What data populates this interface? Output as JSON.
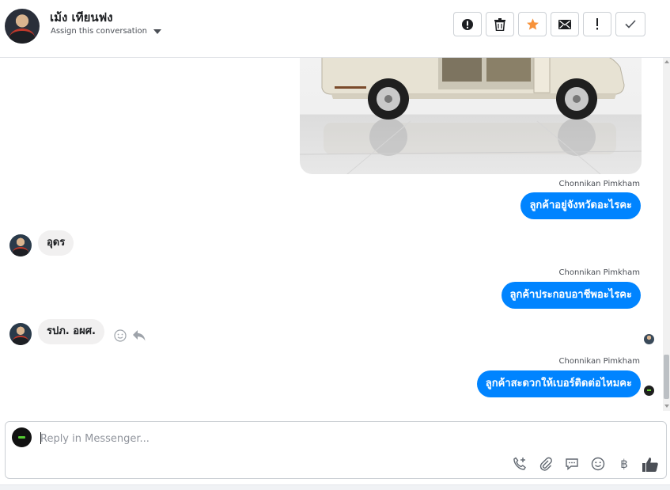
{
  "header": {
    "contact_name": "เม้ง เทียนฟง",
    "assign_label": "Assign this conversation",
    "actions": [
      {
        "name": "mark-spam-button",
        "icon": "alert-circle-icon"
      },
      {
        "name": "delete-button",
        "icon": "trash-icon"
      },
      {
        "name": "star-button",
        "icon": "star-icon",
        "color": "#f7923a"
      },
      {
        "name": "mark-unread-button",
        "icon": "envelope-icon"
      },
      {
        "name": "flag-button",
        "icon": "exclamation-icon"
      },
      {
        "name": "mark-done-button",
        "icon": "checkmark-icon"
      }
    ]
  },
  "messages": [
    {
      "type": "image",
      "direction": "out",
      "icon": "van-photo"
    },
    {
      "type": "text",
      "direction": "out",
      "sender": "Chonnikan Pimkham",
      "text": "ลูกค้าอยู่จังหวัดอะไรคะ"
    },
    {
      "type": "text",
      "direction": "in",
      "text": "อุดร"
    },
    {
      "type": "text",
      "direction": "out",
      "sender": "Chonnikan Pimkham",
      "text": "ลูกค้าประกอบอาชีพอะไรคะ"
    },
    {
      "type": "text",
      "direction": "in",
      "text": "รปภ. อผศ."
    },
    {
      "type": "text",
      "direction": "out",
      "sender": "Chonnikan Pimkham",
      "text": "ลูกค้าสะดวกให้เบอร์ติดต่อไหมคะ"
    }
  ],
  "composer": {
    "placeholder": "Reply in Messenger...",
    "tools": [
      "phone-plus-icon",
      "paperclip-icon",
      "saved-reply-icon",
      "emoji-icon",
      "baht-icon",
      "thumbs-up-icon"
    ],
    "baht_symbol": "฿"
  },
  "colors": {
    "outgoing_bubble": "#0084ff",
    "incoming_bubble": "#f1f0f0",
    "accent_star": "#f7923a"
  }
}
